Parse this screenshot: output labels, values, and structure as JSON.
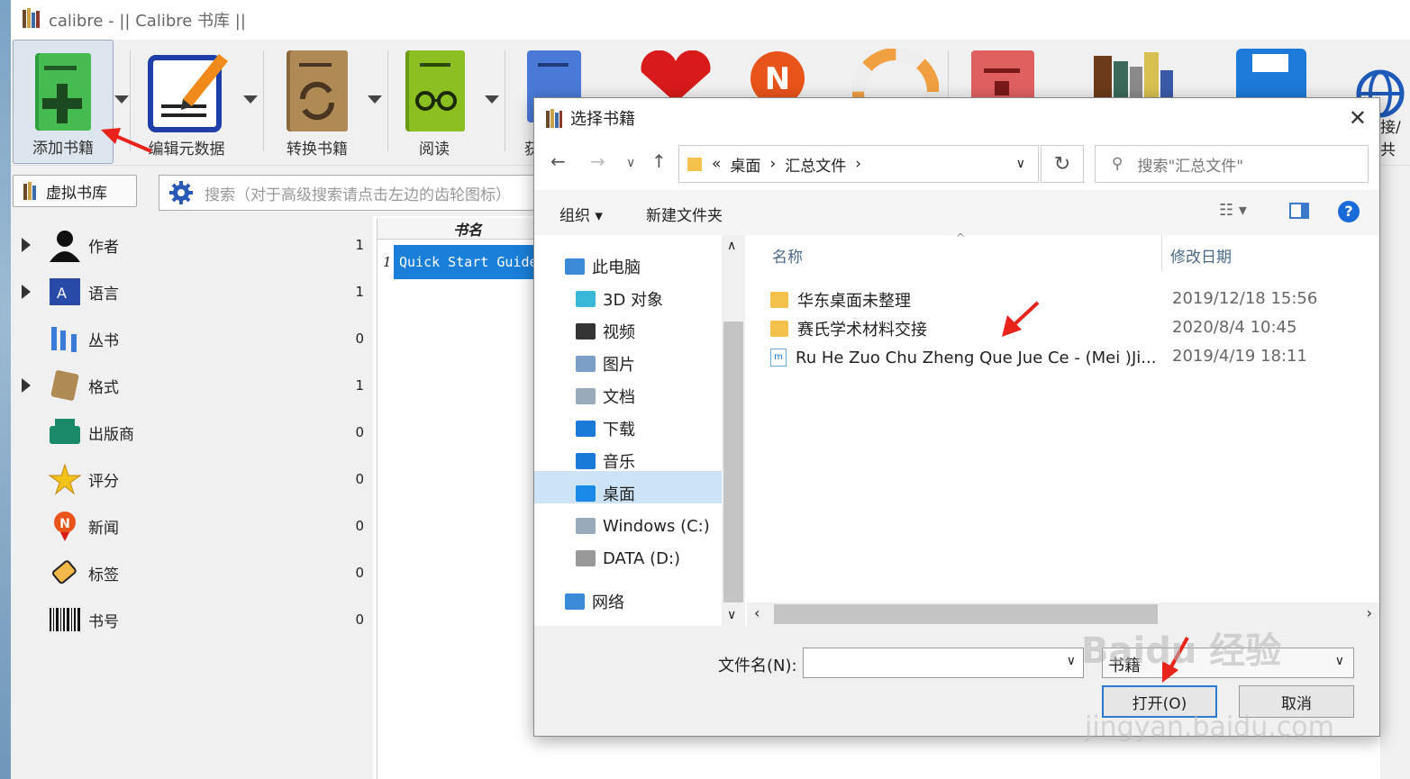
{
  "window": {
    "title": "calibre - || Calibre 书库 ||"
  },
  "toolbar": {
    "add_books": "添加书籍",
    "edit_metadata": "编辑元数据",
    "convert_books": "转换书籍",
    "read": "阅读",
    "clipped_5": "获",
    "clipped_right": "接/共"
  },
  "searchbar": {
    "virtual_library": "虚拟书库",
    "search_placeholder": "搜索（对于高级搜索请点击左边的齿轮图标）"
  },
  "tag_browser": {
    "items": [
      {
        "label": "作者",
        "count": "1",
        "expandable": true,
        "icon": "person-icon"
      },
      {
        "label": "语言",
        "count": "1",
        "expandable": true,
        "icon": "language-icon"
      },
      {
        "label": "丛书",
        "count": "0",
        "expandable": false,
        "icon": "series-icon"
      },
      {
        "label": "格式",
        "count": "1",
        "expandable": true,
        "icon": "book-format-icon"
      },
      {
        "label": "出版商",
        "count": "0",
        "expandable": false,
        "icon": "publisher-icon"
      },
      {
        "label": "评分",
        "count": "0",
        "expandable": false,
        "icon": "star-icon"
      },
      {
        "label": "新闻",
        "count": "0",
        "expandable": false,
        "icon": "news-icon"
      },
      {
        "label": "标签",
        "count": "0",
        "expandable": false,
        "icon": "tag-icon"
      },
      {
        "label": "书号",
        "count": "0",
        "expandable": false,
        "icon": "barcode-icon"
      }
    ]
  },
  "book_list": {
    "column_title": "书名",
    "row_number": "1",
    "row_title": "Quick Start Guide"
  },
  "dialog": {
    "title": "选择书籍",
    "address": {
      "prefix": "«",
      "crumbs": [
        "桌面",
        "汇总文件"
      ]
    },
    "search_placeholder": "搜索\"汇总文件\"",
    "organize": "组织",
    "new_folder": "新建文件夹",
    "nav": [
      {
        "label": "此电脑",
        "icon": "computer-icon"
      },
      {
        "label": "3D 对象",
        "icon": "3d-objects-icon"
      },
      {
        "label": "视频",
        "icon": "video-icon"
      },
      {
        "label": "图片",
        "icon": "pictures-icon"
      },
      {
        "label": "文档",
        "icon": "documents-icon"
      },
      {
        "label": "下载",
        "icon": "download-icon"
      },
      {
        "label": "音乐",
        "icon": "music-icon"
      },
      {
        "label": "桌面",
        "icon": "desktop-icon"
      },
      {
        "label": "Windows (C:)",
        "icon": "drive-c-icon"
      },
      {
        "label": "DATA (D:)",
        "icon": "drive-d-icon"
      },
      {
        "label": "网络",
        "icon": "network-icon"
      }
    ],
    "columns": {
      "name": "名称",
      "modified": "修改日期"
    },
    "files": [
      {
        "name": "华东桌面未整理",
        "date": "2019/12/18 15:56",
        "type": "folder"
      },
      {
        "name": "赛氏学术材料交接",
        "date": "2020/8/4 10:45",
        "type": "folder"
      },
      {
        "name": "Ru He Zuo Chu Zheng Que Jue Ce - (Mei )Ji...",
        "date": "2019/4/19 18:11",
        "type": "mobi"
      }
    ],
    "filename_label": "文件名(N):",
    "filename_value": "",
    "filetype": "书籍",
    "open_button": "打开(O)",
    "cancel_button": "取消"
  },
  "watermark": {
    "line1": "Baidu 经验",
    "line2": "jingyan.baidu.com"
  },
  "colors": {
    "accent": "#1a7fd8",
    "selection": "#cde4f7",
    "annotation": "#e8231b"
  }
}
